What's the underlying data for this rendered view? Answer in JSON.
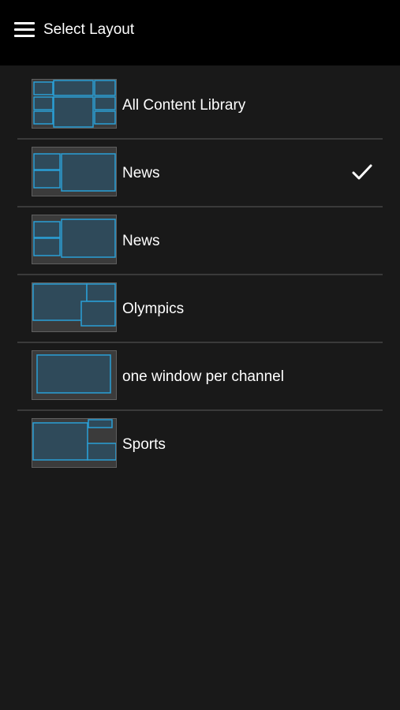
{
  "header": {
    "menu_icon": "hamburger-menu-icon",
    "title": "Select Layout"
  },
  "layouts": [
    {
      "label": "All Content Library",
      "thumbnail": "grid-layout-icon",
      "selected": false
    },
    {
      "label": "News",
      "thumbnail": "news-layout-icon",
      "selected": true
    },
    {
      "label": "News",
      "thumbnail": "news-layout-icon",
      "selected": false
    },
    {
      "label": "Olympics",
      "thumbnail": "olympics-layout-icon",
      "selected": false
    },
    {
      "label": "one window per channel",
      "thumbnail": "single-window-layout-icon",
      "selected": false
    },
    {
      "label": "Sports",
      "thumbnail": "sports-layout-icon",
      "selected": false
    }
  ],
  "colors": {
    "header_bg": "#000000",
    "list_bg": "#191919",
    "thumb_bg": "#3b3b3b",
    "window_stroke": "#2a9fd6",
    "window_fill": "#2f4a5a",
    "text": "#ffffff"
  }
}
